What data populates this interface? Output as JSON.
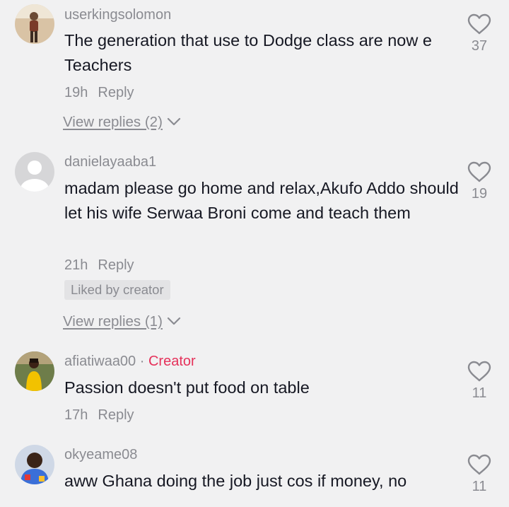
{
  "comments": [
    {
      "username": "userkingsolomon",
      "text": "The generation that use to Dodge class are now e Teachers",
      "time": "19h",
      "reply_label": "Reply",
      "likes": "37",
      "view_replies": "View replies (2)",
      "avatar_color": "#c9a27a"
    },
    {
      "username": "danielayaaba1",
      "text": "madam please go home and relax,Akufo Addo should let his wife Serwaa Broni come and teach them",
      "time": "21h",
      "reply_label": "Reply",
      "likes": "19",
      "liked_by": "Liked by creator",
      "view_replies": "View replies (1)",
      "avatar_color": "#d6d6d8"
    },
    {
      "username": "afiatiwaa00",
      "separator": "·",
      "creator_badge": "Creator",
      "text": "Passion doesn't put food on table",
      "time": "17h",
      "reply_label": "Reply",
      "likes": "11",
      "avatar_color": "#e8b800"
    },
    {
      "username": "okyeame08",
      "text": "aww Ghana doing the job just cos if money, no",
      "likes": "11",
      "avatar_color": "#3a6fd8"
    }
  ],
  "icons": {
    "like": "heart-outline-icon",
    "expand": "chevron-down-icon",
    "default_avatar": "default-avatar-icon"
  },
  "colors": {
    "background": "#f1f1f2",
    "text": "#161823",
    "secondary": "#8a8b91",
    "creator": "#e5315a"
  }
}
